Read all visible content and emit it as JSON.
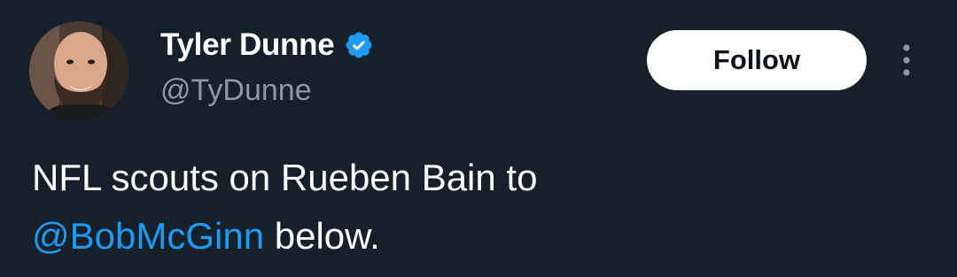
{
  "author": {
    "display_name": "Tyler Dunne",
    "handle": "@TyDunne",
    "verified_icon": "verified-badge-icon",
    "avatar_icon": "avatar"
  },
  "actions": {
    "follow_label": "Follow",
    "more_icon": "more-vertical-icon"
  },
  "tweet": {
    "line1": "NFL scouts on Rueben Bain to",
    "mention": "@BobMcGinn",
    "line2_rest": " below."
  },
  "colors": {
    "background": "#15202b",
    "accent": "#1d9bf0",
    "secondary_text": "#8b98a5",
    "primary_text": "#ffffff"
  }
}
